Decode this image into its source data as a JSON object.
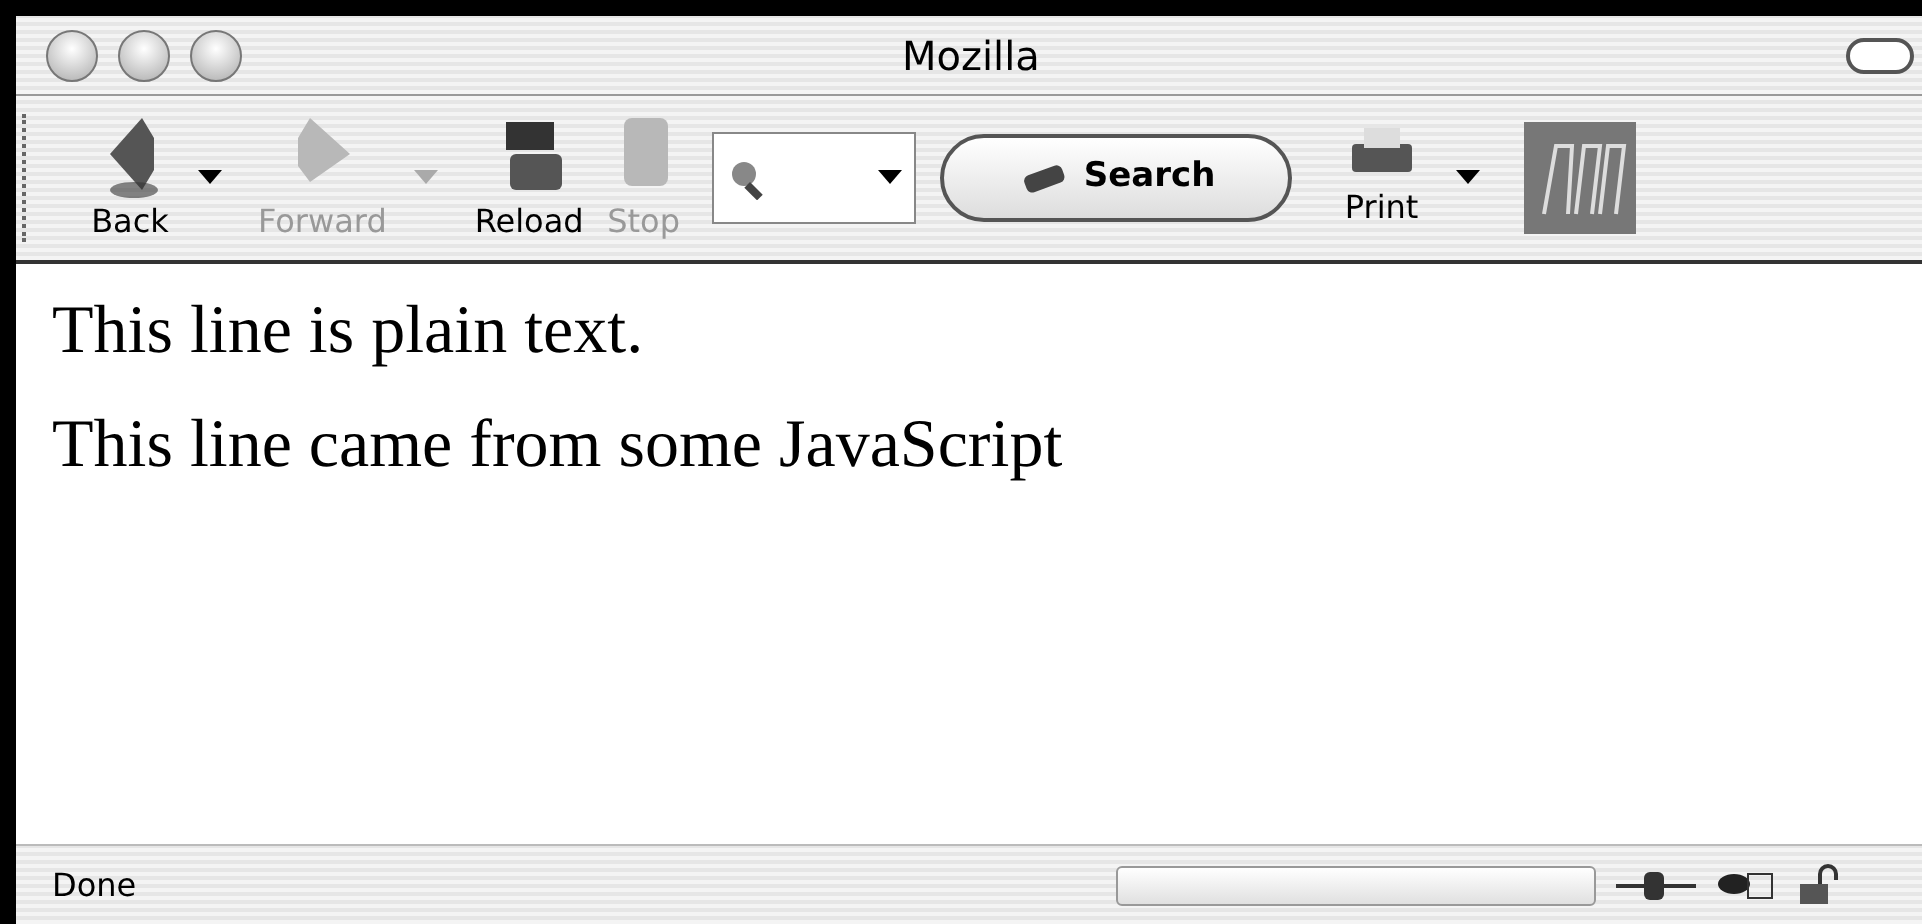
{
  "window": {
    "title": "Mozilla"
  },
  "toolbar": {
    "buttons": [
      {
        "kind": "back",
        "label": "Back",
        "disabled": false,
        "menu": true
      },
      {
        "kind": "forward",
        "label": "Forward",
        "disabled": true,
        "menu": true
      },
      {
        "kind": "reload",
        "label": "Reload",
        "disabled": false,
        "menu": false
      },
      {
        "kind": "stop",
        "label": "Stop",
        "disabled": true,
        "menu": false
      }
    ],
    "search_label": "Search",
    "print_label": "Print"
  },
  "content": {
    "paragraphs": [
      "This line is plain text.",
      "This line came from some JavaScript"
    ]
  },
  "status_bar": {
    "text": "Done",
    "progress": {
      "level": 0
    }
  }
}
